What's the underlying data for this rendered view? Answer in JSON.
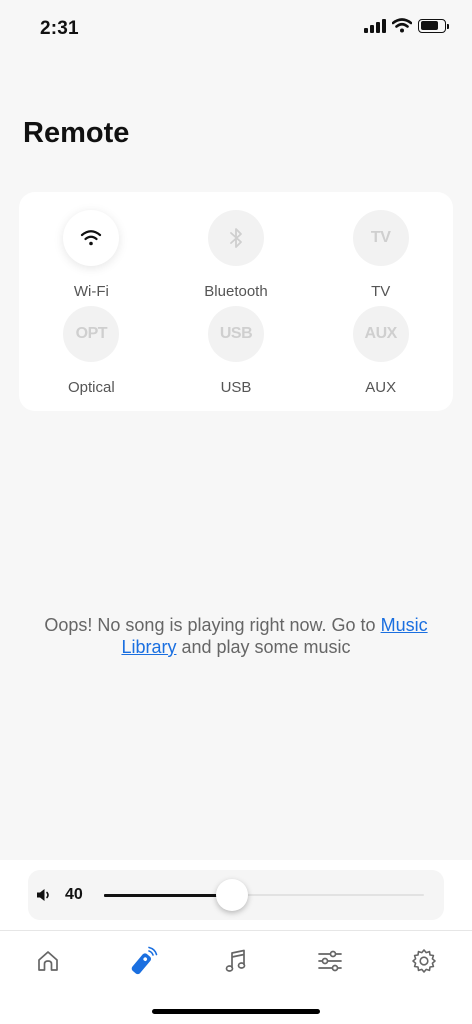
{
  "status_bar": {
    "time": "2:31",
    "battery_level": 0.75
  },
  "page": {
    "title": "Remote"
  },
  "sources": [
    {
      "label": "Wi-Fi",
      "icon": "wifi-icon",
      "active": true
    },
    {
      "label": "Bluetooth",
      "icon": "bluetooth-icon",
      "active": false
    },
    {
      "label": "TV",
      "badge": "TV",
      "active": false
    },
    {
      "label": "Optical",
      "badge": "OPT",
      "active": false
    },
    {
      "label": "USB",
      "badge": "USB",
      "active": false
    },
    {
      "label": "AUX",
      "badge": "AUX",
      "active": false
    }
  ],
  "empty_message": {
    "text_before": "Oops! No song is playing right now. Go to ",
    "link": "Music Library",
    "text_after": " and play some music"
  },
  "volume": {
    "value": "40",
    "level": 0.4
  },
  "tabs": [
    {
      "name": "home",
      "icon": "home-icon",
      "active": false
    },
    {
      "name": "remote",
      "icon": "remote-icon",
      "active": true
    },
    {
      "name": "music",
      "icon": "music-note-icon",
      "active": false
    },
    {
      "name": "equalizer",
      "icon": "sliders-icon",
      "active": false
    },
    {
      "name": "settings",
      "icon": "gear-icon",
      "active": false
    }
  ],
  "colors": {
    "accent": "#1a6fe0",
    "link": "#1a6fe0",
    "background": "#f7f7f7"
  }
}
